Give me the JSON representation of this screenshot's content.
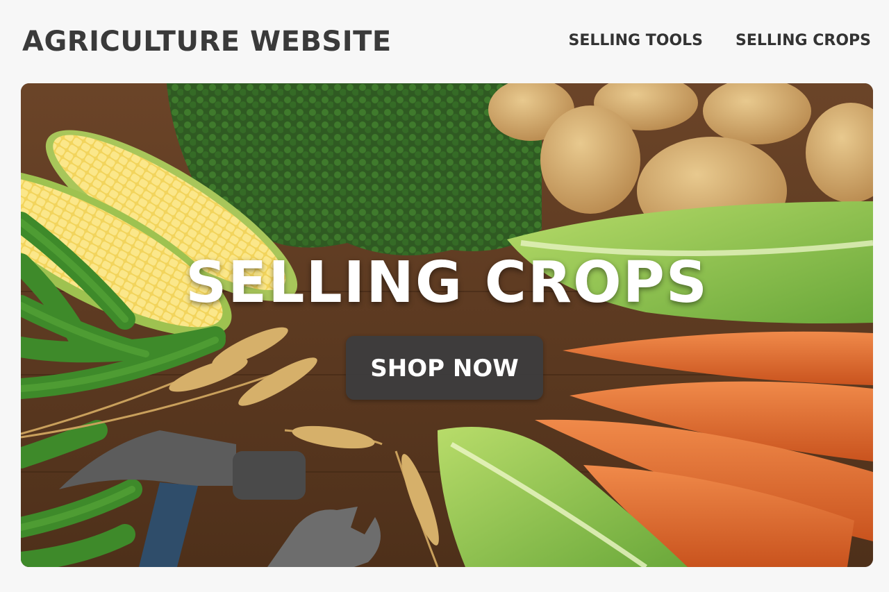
{
  "header": {
    "site_title": "AGRICULTURE WEBSITE",
    "nav": [
      {
        "label": "SELLING TOOLS"
      },
      {
        "label": "SELLING CROPS"
      }
    ]
  },
  "hero": {
    "title": "SELLING CROPS",
    "cta_label": "SHOP NOW"
  },
  "colors": {
    "background": "#f7f7f7",
    "title_text": "#3a3a3a",
    "button_bg": "#3c3c3e",
    "hero_text": "#ffffff"
  }
}
